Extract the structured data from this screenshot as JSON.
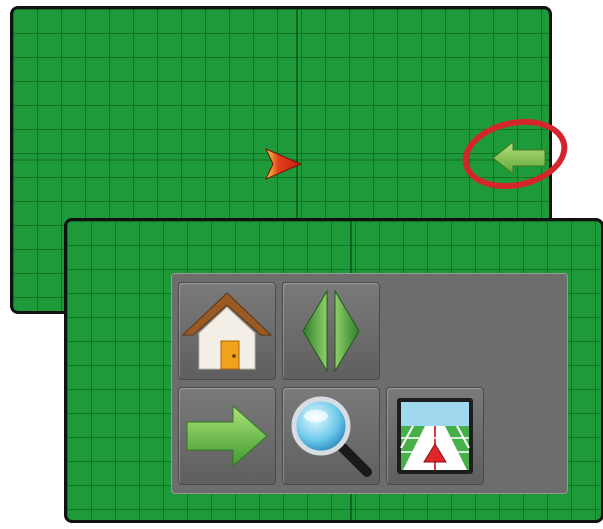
{
  "screen": {
    "background": "field-grid",
    "grid_color": "#1f9a3a"
  },
  "map": {
    "vehicle_marker": "vehicle-arrow-icon",
    "return_button_icon": "return-to-vehicle-arrow-icon",
    "highlight_color": "#d4252c"
  },
  "menu": {
    "buttons": [
      {
        "id": "home",
        "icon": "house-icon"
      },
      {
        "id": "pan",
        "icon": "pan-left-right-icon"
      },
      {
        "id": "return-to-vehicle",
        "icon": "green-arrow-right-icon"
      },
      {
        "id": "zoom",
        "icon": "magnifier-icon"
      },
      {
        "id": "vehicle-view",
        "icon": "vehicle-view-icon"
      }
    ]
  }
}
